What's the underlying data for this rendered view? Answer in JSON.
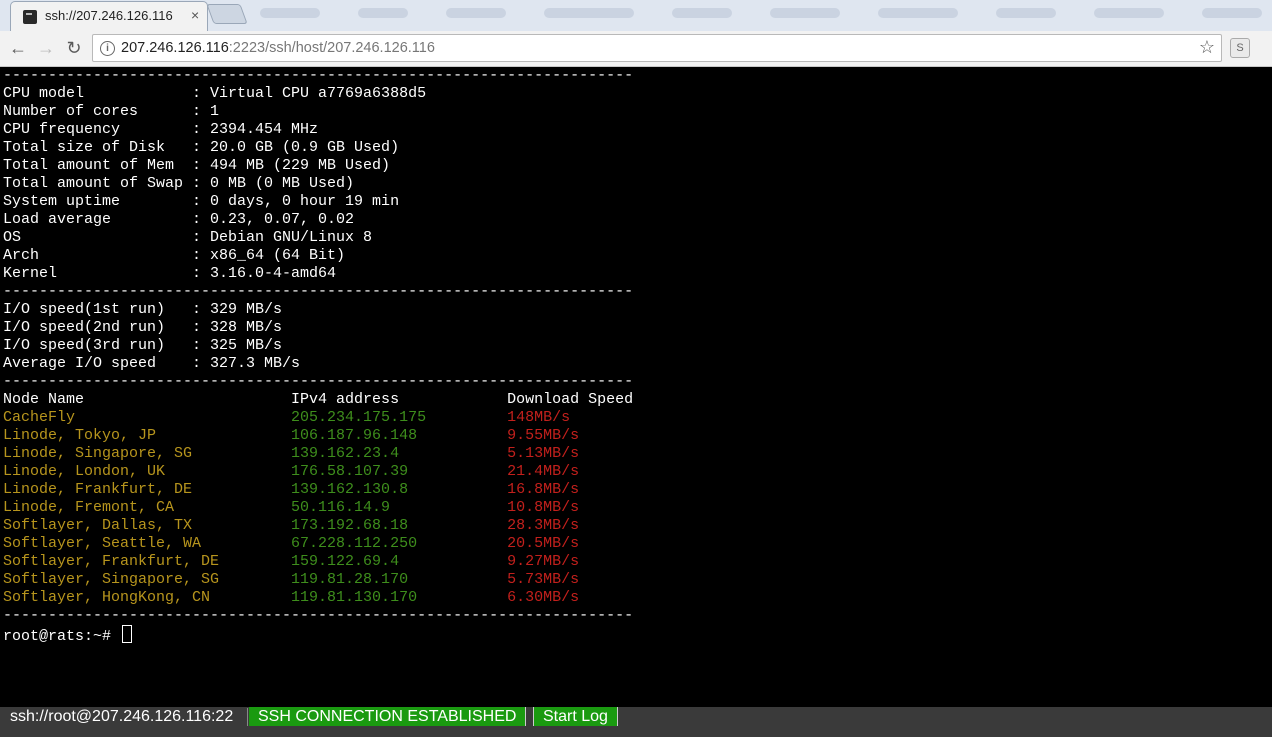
{
  "browser": {
    "tab_title": "ssh://207.246.126.116",
    "tab_close": "×",
    "url_host": "207.246.126.116",
    "url_rest": ":2223/ssh/host/207.246.126.116",
    "back_glyph": "←",
    "forward_glyph": "→",
    "reload_glyph": "↻",
    "star_glyph": "☆",
    "info_glyph": "i",
    "ext_glyph": "S"
  },
  "terminal": {
    "lines": [
      {
        "text": "----------------------------------------------------------------------"
      },
      {
        "text": "CPU model            : Virtual CPU a7769a6388d5"
      },
      {
        "text": "Number of cores      : 1"
      },
      {
        "text": "CPU frequency        : 2394.454 MHz"
      },
      {
        "text": "Total size of Disk   : 20.0 GB (0.9 GB Used)"
      },
      {
        "text": "Total amount of Mem  : 494 MB (229 MB Used)"
      },
      {
        "text": "Total amount of Swap : 0 MB (0 MB Used)"
      },
      {
        "text": "System uptime        : 0 days, 0 hour 19 min"
      },
      {
        "text": "Load average         : 0.23, 0.07, 0.02"
      },
      {
        "text": "OS                   : Debian GNU/Linux 8"
      },
      {
        "text": "Arch                 : x86_64 (64 Bit)"
      },
      {
        "text": "Kernel               : 3.16.0-4-amd64"
      },
      {
        "text": "----------------------------------------------------------------------"
      },
      {
        "text": "I/O speed(1st run)   : 329 MB/s"
      },
      {
        "text": "I/O speed(2nd run)   : 328 MB/s"
      },
      {
        "text": "I/O speed(3rd run)   : 325 MB/s"
      },
      {
        "text": "Average I/O speed    : 327.3 MB/s"
      },
      {
        "text": "----------------------------------------------------------------------"
      },
      {
        "text": "Node Name                       IPv4 address            Download Speed"
      }
    ],
    "nodes": [
      {
        "name": "CacheFly",
        "ip": "205.234.175.175",
        "speed": "148MB/s"
      },
      {
        "name": "Linode, Tokyo, JP",
        "ip": "106.187.96.148",
        "speed": "9.55MB/s"
      },
      {
        "name": "Linode, Singapore, SG",
        "ip": "139.162.23.4",
        "speed": "5.13MB/s"
      },
      {
        "name": "Linode, London, UK",
        "ip": "176.58.107.39",
        "speed": "21.4MB/s"
      },
      {
        "name": "Linode, Frankfurt, DE",
        "ip": "139.162.130.8",
        "speed": "16.8MB/s"
      },
      {
        "name": "Linode, Fremont, CA",
        "ip": "50.116.14.9",
        "speed": "10.8MB/s"
      },
      {
        "name": "Softlayer, Dallas, TX",
        "ip": "173.192.68.18",
        "speed": "28.3MB/s"
      },
      {
        "name": "Softlayer, Seattle, WA",
        "ip": "67.228.112.250",
        "speed": "20.5MB/s"
      },
      {
        "name": "Softlayer, Frankfurt, DE",
        "ip": "159.122.69.4",
        "speed": "9.27MB/s"
      },
      {
        "name": "Softlayer, Singapore, SG",
        "ip": "119.81.28.170",
        "speed": "5.73MB/s"
      },
      {
        "name": "Softlayer, HongKong, CN",
        "ip": "119.81.130.170",
        "speed": "6.30MB/s"
      }
    ],
    "footer_rule": "----------------------------------------------------------------------",
    "prompt": "root@rats:~# "
  },
  "statusbar": {
    "session": "ssh://root@207.246.126.116:22",
    "status": "SSH CONNECTION ESTABLISHED",
    "start_log": "Start Log"
  },
  "colors": {
    "node_name": "#b7951d",
    "ip": "#3e8e1c",
    "speed": "#c2201c",
    "status_green": "#1a9a10"
  }
}
